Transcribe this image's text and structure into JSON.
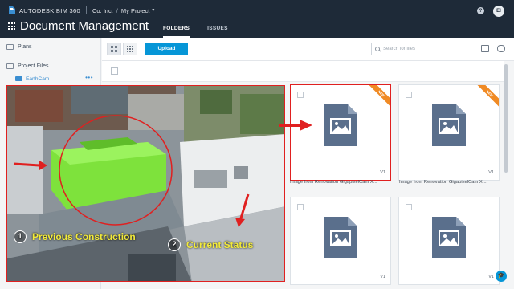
{
  "header": {
    "brand": "AUTODESK BIM 360",
    "company": "Co. Inc.",
    "project": "My Project",
    "app_title": "Document Management",
    "tabs": [
      {
        "label": "FOLDERS",
        "active": true
      },
      {
        "label": "ISSUES",
        "active": false
      }
    ],
    "help_glyph": "?",
    "avatar_initials": "EI"
  },
  "sidebar": {
    "items": [
      {
        "label": "Plans"
      },
      {
        "label": "Project Files"
      }
    ],
    "subfolder": {
      "label": "EarthCam",
      "more": "•••"
    }
  },
  "toolbar": {
    "upload_label": "Upload",
    "search_placeholder": "Search for files"
  },
  "cards": [
    {
      "name": "Image from Renovation GigapixelCam X...",
      "version": "V1",
      "badge": "NEW",
      "highlighted": true
    },
    {
      "name": "Image from Renovation GigapixelCam X...",
      "version": "V1",
      "badge": "NEW",
      "highlighted": false
    },
    {
      "name": "",
      "version": "V1",
      "badge": "",
      "highlighted": false
    },
    {
      "name": "",
      "version": "V1",
      "badge": "",
      "highlighted": false
    }
  ],
  "overlay": {
    "label1_num": "1",
    "label1": "Previous Construction",
    "label2_num": "2",
    "label2": "Current Status"
  },
  "colors": {
    "topbar": "#1e2a38",
    "accent": "#0696d7",
    "highlight": "#e02020",
    "ribbon": "#f08a24",
    "file_icon": "#5a6f8c",
    "bim_green": "#7ee23c"
  }
}
